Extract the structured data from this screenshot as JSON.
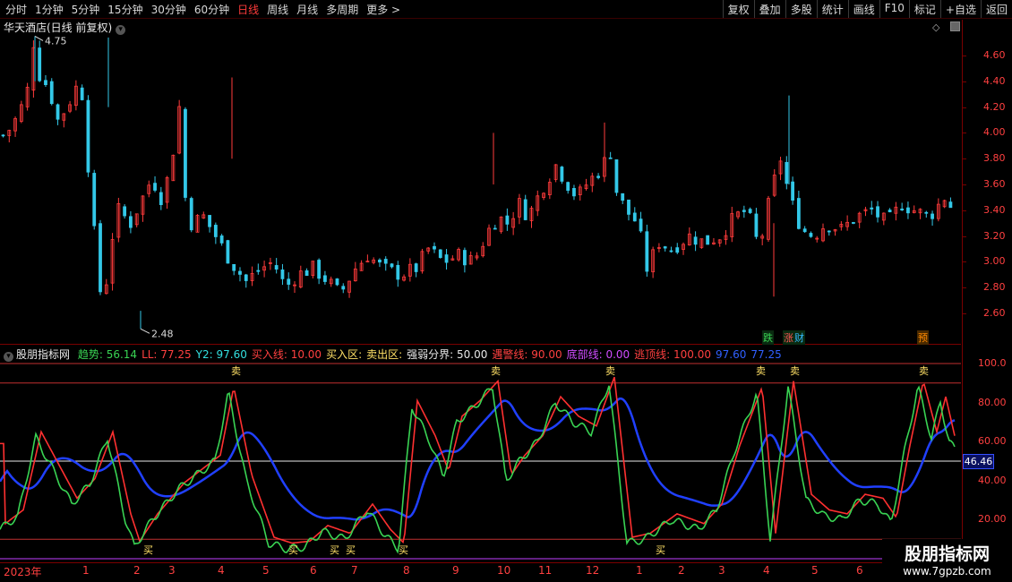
{
  "topbar": {
    "periods": [
      "分时",
      "1分钟",
      "5分钟",
      "15分钟",
      "30分钟",
      "60分钟",
      "日线",
      "周线",
      "月线",
      "多周期",
      "更多 >"
    ],
    "active_period": "日线",
    "tools": [
      "复权",
      "叠加",
      "多股",
      "统计",
      "画线",
      "F10",
      "标记",
      "+自选",
      "返回"
    ]
  },
  "chart_title": "华天酒店(日线 前复权)",
  "price_axis": [
    "4.60",
    "4.40",
    "4.20",
    "4.00",
    "3.80",
    "3.60",
    "3.40",
    "3.20",
    "3.00",
    "2.80",
    "2.60"
  ],
  "price_annotations": {
    "high": "4.75",
    "low": "2.48"
  },
  "event_tags": [
    {
      "text": "跌",
      "color": "#39d353"
    },
    {
      "text": "涨",
      "color": "#ff5555"
    },
    {
      "text": "财",
      "color": "#33bbff"
    },
    {
      "text": "预",
      "color": "#ff8800"
    }
  ],
  "indicator": {
    "name": "股朋指标网",
    "fields": [
      {
        "label": "趋势: 56.14",
        "color": "#39d353"
      },
      {
        "label": "LL: 77.25",
        "color": "#ff4040"
      },
      {
        "label": "Y2: 97.60",
        "color": "#33e0e0"
      },
      {
        "label": "买入线: 10.00",
        "color": "#ff4040"
      },
      {
        "label": "买入区:",
        "color": "#ffe066"
      },
      {
        "label": "卖出区:",
        "color": "#ffe066"
      },
      {
        "label": "强弱分界: 50.00",
        "color": "#e8e8e8"
      },
      {
        "label": "遇警线: 90.00",
        "color": "#ff4040"
      },
      {
        "label": "底部线: 0.00",
        "color": "#d04cff"
      },
      {
        "label": "逃顶线: 100.00",
        "color": "#ff4040"
      },
      {
        "label": "97.60",
        "color": "#3060ff"
      },
      {
        "label": "77.25",
        "color": "#3060ff"
      }
    ],
    "axis": [
      "100.0",
      "80.00",
      "60.00",
      "40.00",
      "20.00"
    ],
    "current": "46.46",
    "buy_label": "买",
    "sell_label": "卖"
  },
  "x_axis": [
    "2023年",
    "1",
    "2",
    "3",
    "4",
    "5",
    "6",
    "7",
    "8",
    "9",
    "10",
    "11",
    "12",
    "1",
    "2",
    "3",
    "4",
    "5",
    "6"
  ],
  "watermark": {
    "title": "股朋指标网",
    "url": "www.7gpzb.com"
  },
  "colors": {
    "up": "#ff3b3b",
    "down": "#33c8e8",
    "trend": "#39d353",
    "ll": "#ff3030",
    "y2": "#2bb8c8",
    "blue": "#2040ff"
  }
}
